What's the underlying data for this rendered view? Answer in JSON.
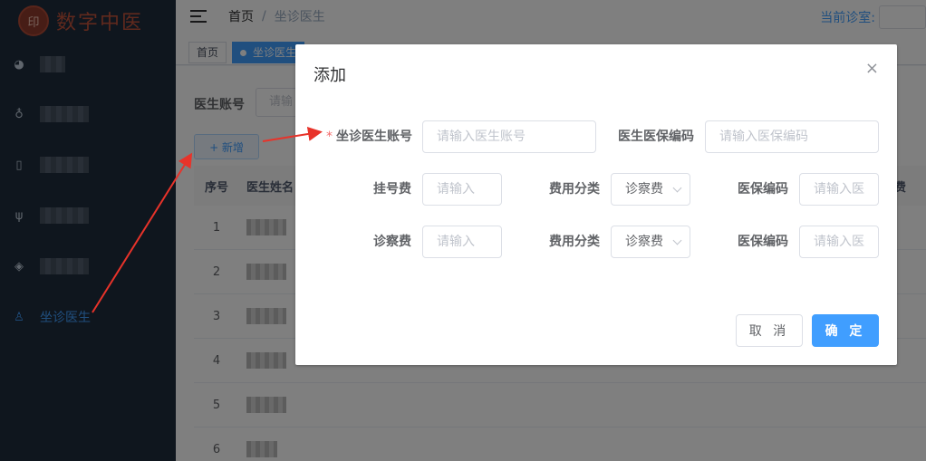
{
  "app": {
    "logo_text": "数字中医",
    "logo_seal": "印"
  },
  "sidebar": {
    "items": [
      {
        "icon": "dashboard-icon",
        "label": ""
      },
      {
        "icon": "users-icon",
        "label": ""
      },
      {
        "icon": "document-icon",
        "label": ""
      },
      {
        "icon": "stethoscope-icon",
        "label": ""
      },
      {
        "icon": "layers-icon",
        "label": ""
      },
      {
        "icon": "doctor-icon",
        "label": "坐诊医生",
        "active": true
      }
    ]
  },
  "navbar": {
    "breadcrumb": [
      "首页",
      "坐诊医生"
    ],
    "separator": "/",
    "current_room_label": "当前诊室:"
  },
  "tags": [
    "首页",
    "坐诊医生"
  ],
  "page": {
    "filter_label": "医生账号",
    "filter_placeholder": "请输",
    "add_button": "+ 新增",
    "table_headers": [
      "序号",
      "医生姓名",
      "费"
    ],
    "rows": [
      "1",
      "2",
      "3",
      "4",
      "5",
      "6"
    ]
  },
  "dialog": {
    "title": "添加",
    "close_icon": "×",
    "required_mark": "*",
    "fields": {
      "account_label": "坐诊医生账号",
      "account_placeholder": "请输入医生账号",
      "insurance_code_label": "医生医保编码",
      "insurance_code_placeholder": "请输入医保编码",
      "reg_fee_label": "挂号费",
      "reg_fee_placeholder": "请输入",
      "reg_category_label": "费用分类",
      "reg_category_value": "诊察费",
      "reg_insurance_label": "医保编码",
      "reg_insurance_placeholder": "请输入医",
      "consult_fee_label": "诊察费",
      "consult_fee_placeholder": "请输入",
      "consult_category_label": "费用分类",
      "consult_category_value": "诊察费",
      "consult_insurance_label": "医保编码",
      "consult_insurance_placeholder": "请输入医"
    },
    "cancel_button": "取 消",
    "confirm_button": "确 定"
  },
  "colors": {
    "sidebar_bg": "#1f2d3d",
    "accent": "#409eff",
    "required": "#f56c6c",
    "annotation_arrow": "#e8332a"
  }
}
